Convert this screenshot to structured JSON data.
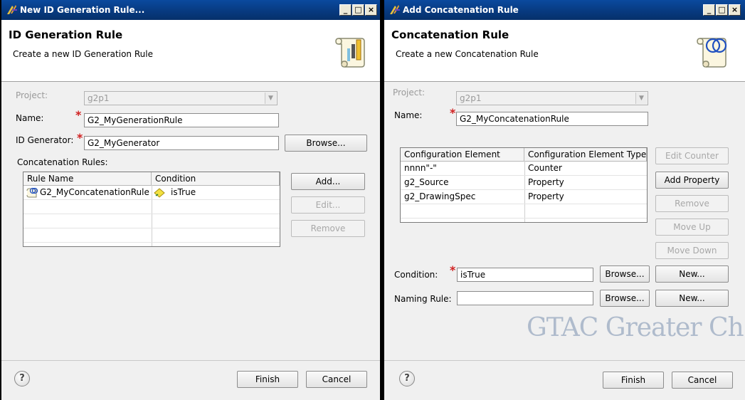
{
  "left_dialog": {
    "window_title": "New ID Generation Rule...",
    "window_buttons": [
      "_",
      "□",
      "×"
    ],
    "header_title": "ID Generation Rule",
    "header_subtitle": "Create a new ID Generation Rule",
    "project_label": "Project:",
    "project_value": "g2p1",
    "name_label": "Name:",
    "name_value": "G2_MyGenerationRule",
    "id_generator_label": "ID Generator:",
    "id_generator_value": "G2_MyGenerator",
    "browse_label": "Browse...",
    "concat_rules_label": "Concatenation Rules:",
    "table": {
      "columns": [
        "Rule Name",
        "Condition"
      ],
      "rows": [
        {
          "rule_name": "G2_MyConcatenationRule",
          "condition": "isTrue"
        }
      ]
    },
    "add_label": "Add...",
    "edit_label": "Edit...",
    "remove_label": "Remove",
    "finish_label": "Finish",
    "cancel_label": "Cancel",
    "help_glyph": "?"
  },
  "right_dialog": {
    "window_title": "Add Concatenation Rule",
    "window_buttons": [
      "_",
      "□",
      "×"
    ],
    "header_title": "Concatenation Rule",
    "header_subtitle": "Create a new Concatenation Rule",
    "project_label": "Project:",
    "project_value": "g2p1",
    "name_label": "Name:",
    "name_value": "G2_MyConcatenationRule",
    "table": {
      "columns": [
        "Configuration Element",
        "Configuration Element Type"
      ],
      "rows": [
        {
          "element": "nnnn\"-\"",
          "type": "Counter"
        },
        {
          "element": "g2_Source",
          "type": "Property"
        },
        {
          "element": "g2_DrawingSpec",
          "type": "Property"
        }
      ]
    },
    "edit_counter_label": "Edit Counter",
    "add_property_label": "Add Property",
    "remove_label": "Remove",
    "move_up_label": "Move Up",
    "move_down_label": "Move Down",
    "condition_label": "Condition:",
    "condition_value": "isTrue",
    "naming_rule_label": "Naming Rule:",
    "naming_rule_value": "",
    "browse_label": "Browse...",
    "new_label": "New...",
    "watermark": "GTAC Greater Ch",
    "finish_label": "Finish",
    "cancel_label": "Cancel",
    "help_glyph": "?"
  },
  "colors": {
    "titlebar": "#07397e",
    "required": "#d02020",
    "disabled_text": "#9a9a9a"
  }
}
